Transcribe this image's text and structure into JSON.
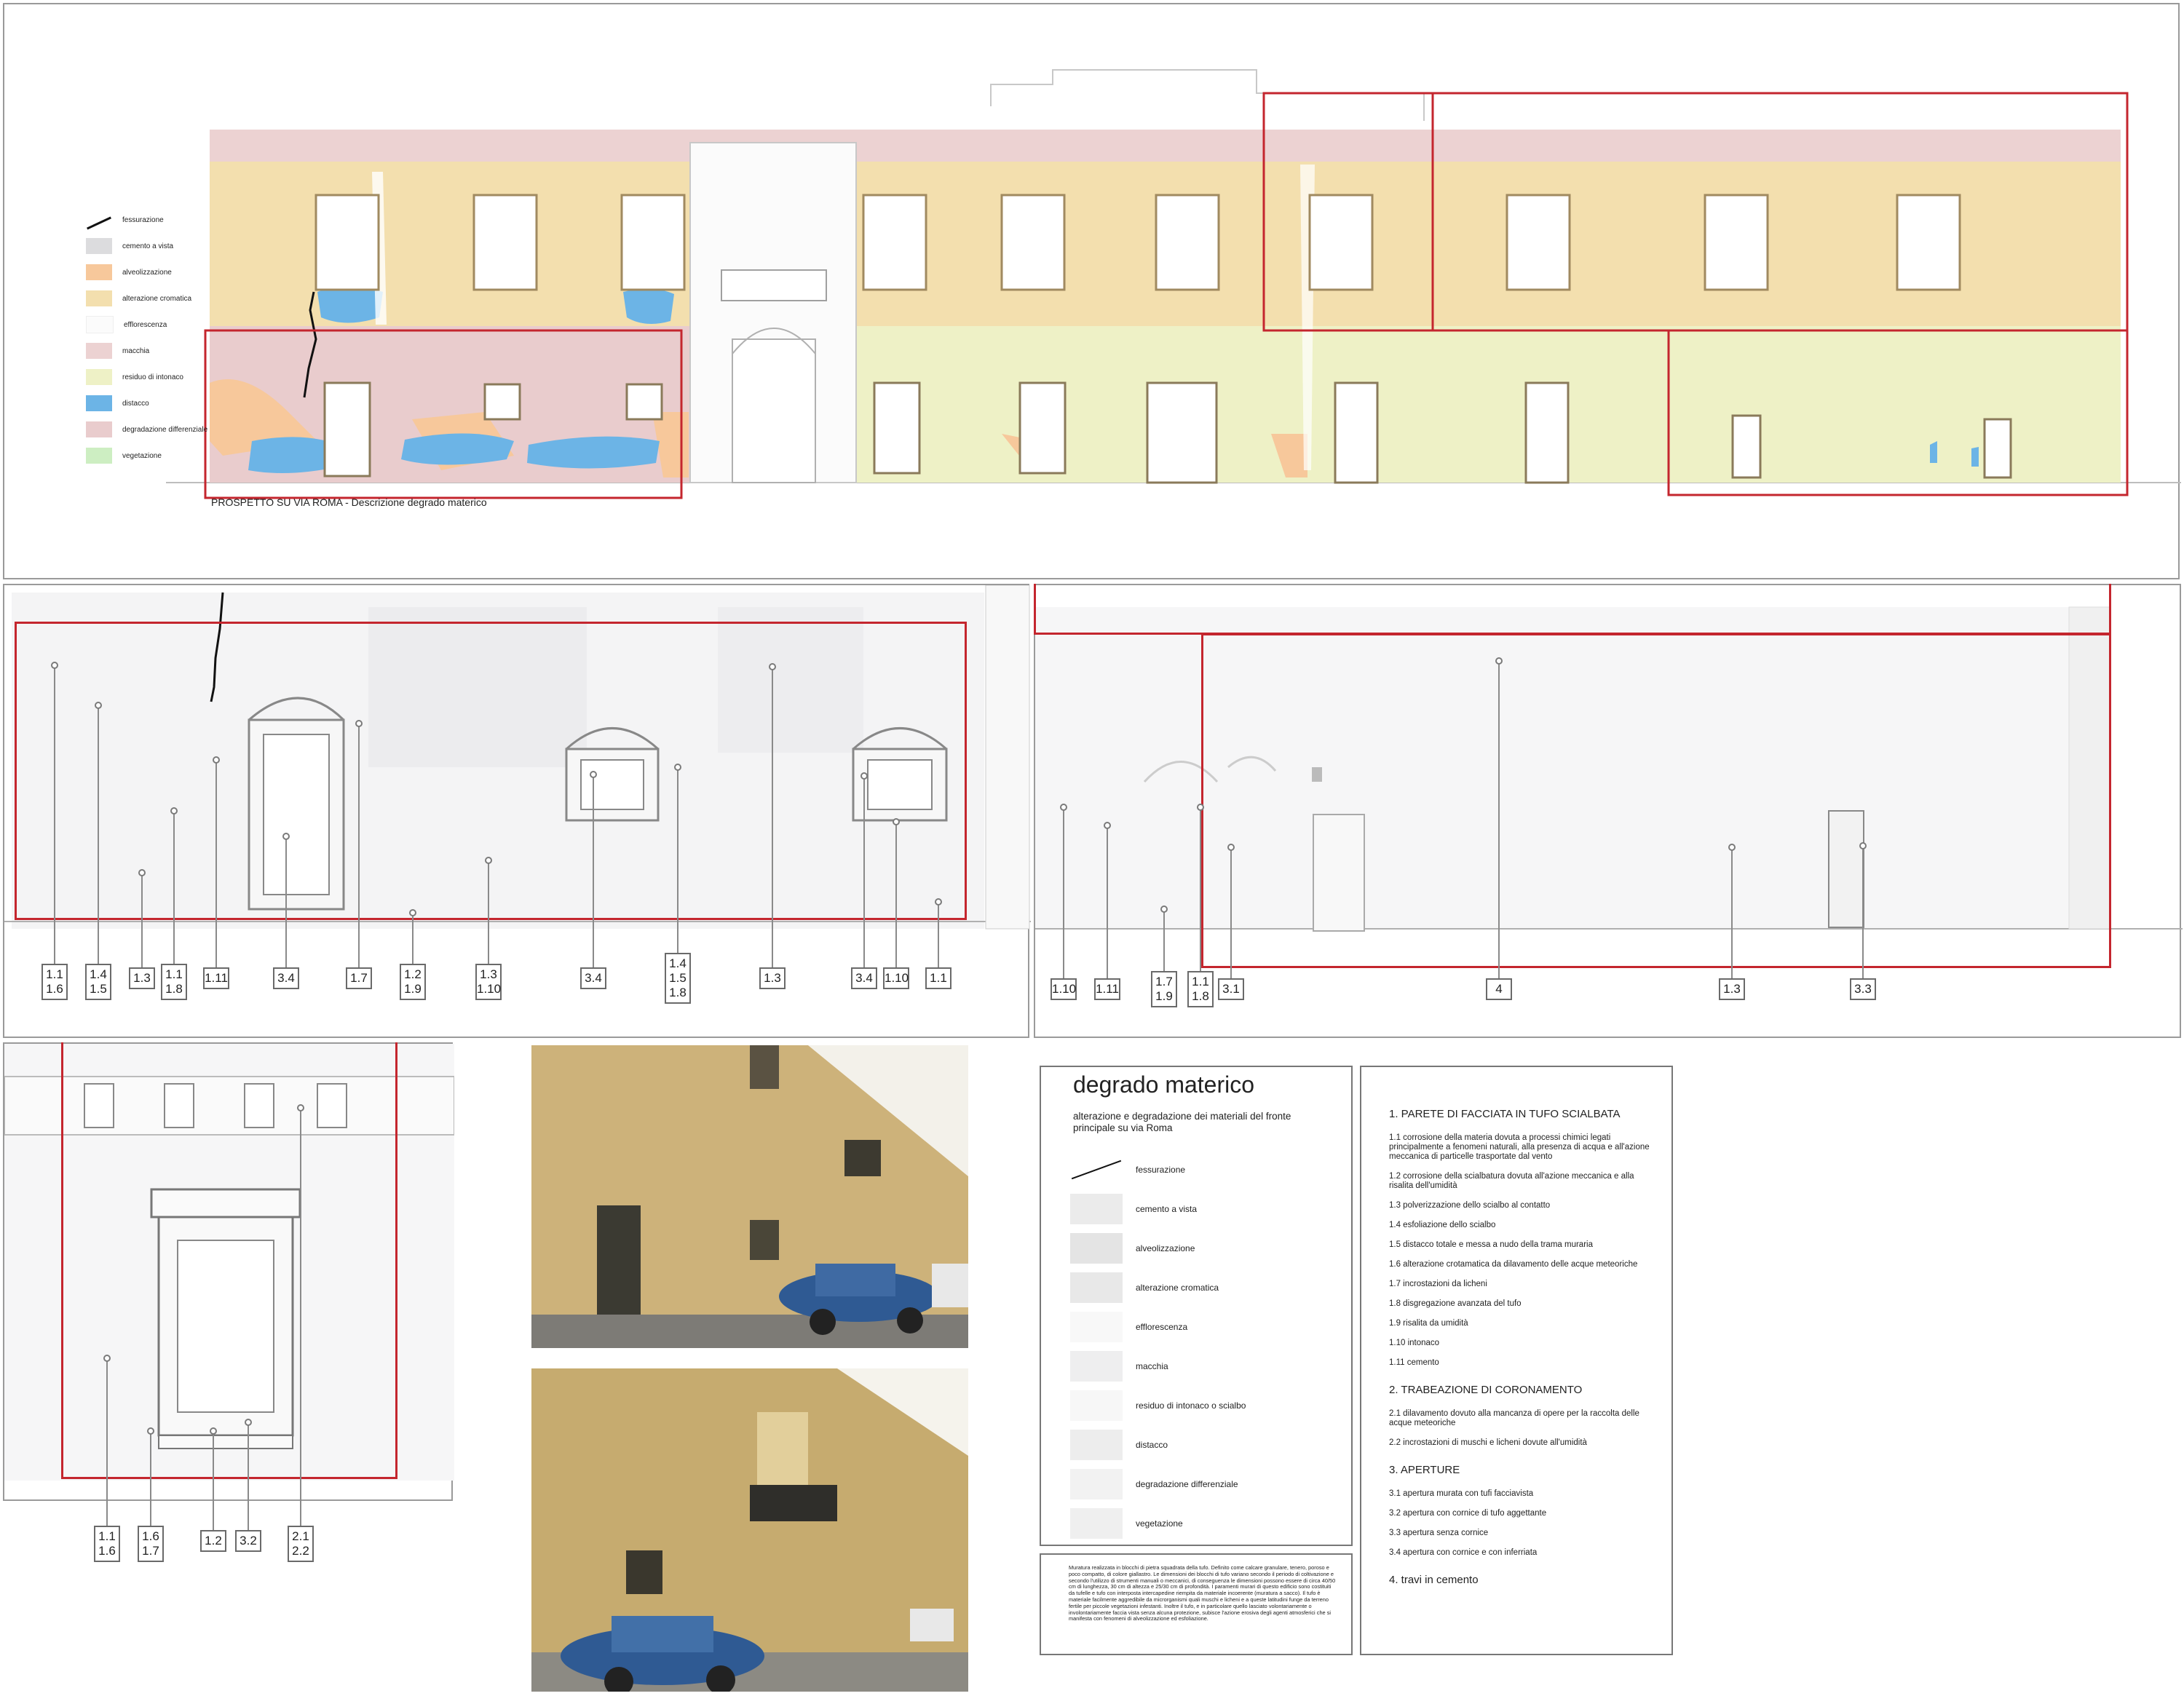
{
  "elevation": {
    "caption": "PROSPETTO SU VIA ROMA - Descrizione degrado materico",
    "legend": [
      {
        "label": "fessurazione",
        "color": "#111111",
        "kind": "crack"
      },
      {
        "label": "cemento a vista",
        "color": "#dcdcde"
      },
      {
        "label": "alveolizzazione",
        "color": "#f7c89b"
      },
      {
        "label": "alterazione cromatica",
        "color": "#f3dfae"
      },
      {
        "label": "efflorescenza",
        "color": "#fbfbfb"
      },
      {
        "label": "macchia",
        "color": "#ecd2d2"
      },
      {
        "label": "residuo di intonaco",
        "color": "#eef1c6"
      },
      {
        "label": "distacco",
        "color": "#6cb4e6"
      },
      {
        "label": "degradazione differenziale",
        "color": "#e9cccd"
      },
      {
        "label": "vegetazione",
        "color": "#cdeec2"
      }
    ]
  },
  "detail_left": {
    "tags": [
      [
        "1.1",
        "1.6"
      ],
      [
        "1.4",
        "1.5"
      ],
      [
        "1.3"
      ],
      [
        "1.1",
        "1.8"
      ],
      [
        "1.11"
      ],
      [
        "3.4"
      ],
      [
        "1.7"
      ],
      [
        "1.2",
        "1.9"
      ],
      [
        "1.3",
        "1.10"
      ],
      [
        "3.4"
      ],
      [
        "1.4",
        "1.5",
        "1.8"
      ],
      [
        "1.3"
      ],
      [
        "3.4"
      ],
      [
        "1.10"
      ],
      [
        "1.1"
      ]
    ]
  },
  "detail_right": {
    "tags": [
      [
        "1.10"
      ],
      [
        "1.11"
      ],
      [
        "1.7",
        "1.9"
      ],
      [
        "1.1",
        "1.8"
      ],
      [
        "3.1"
      ],
      [
        "4"
      ],
      [
        "1.3"
      ],
      [
        "3.3"
      ]
    ]
  },
  "detail_window": {
    "tags": [
      [
        "1.1",
        "1.6"
      ],
      [
        "1.6",
        "1.7"
      ],
      [
        "1.2"
      ],
      [
        "3.2"
      ],
      [
        "2.1",
        "2.2"
      ]
    ]
  },
  "key": {
    "title": "degrado materico",
    "subtitle": "alterazione e degradazione dei materiali del fronte principale su via Roma",
    "items": [
      "fessurazione",
      "cemento a vista",
      "alveolizzazione",
      "alterazione cromatica",
      "efflorescenza",
      "macchia",
      "residuo di intonaco o scialbo",
      "distacco",
      "degradazione differenziale",
      "vegetazione"
    ],
    "note": "Muratura realizzata in blocchi di pietra squadrata della tufo. Definito come calcare granulare, tenero, poroso e poco compatto, di colore giallastro. Le dimensioni dei blocchi di tufo variano secondo il periodo di coltivazione e secondo l'utilizzo di strumenti manuali o meccanici, di conseguenza le dimensioni possono essere di circa 40/50 cm di lunghezza, 30 cm di altezza e 25/30 cm di profondità. I paramenti murari di questo edificio sono costituiti da tufelle e tufo con interposta intercapedine riempita da materiale incoerente (muratura a sacco). Il tufo è materiale facilmente aggredibile da microrganismi quali muschi e licheni e a queste latitudini funge da terreno fertile per piccole vegetazioni infestanti. Inoltre il tufo, e in particolare quello lasciato volontariamente o involontariamente faccia vista senza alcuna protezione, subisce l'azione erosiva degli agenti atmosferici che si manifesta con fenomeni di alveolizzazione ed esfoliazione."
  },
  "descriptions": {
    "sections": [
      {
        "heading": "1. PARETE DI FACCIATA IN TUFO SCIALBATA",
        "items": [
          "1.1 corrosione della materia dovuta a processi chimici legati principalmente a fenomeni naturali, alla presenza di acqua e all'azione meccanica di particelle trasportate dal vento",
          "1.2 corrosione della scialbatura dovuta all'azione meccanica e alla risalita dell'umidità",
          "1.3 polverizzazione dello scialbo al contatto",
          "1.4 esfoliazione dello scialbo",
          "1.5 distacco totale e messa a nudo della trama muraria",
          "1.6 alterazione crotamatica da dilavamento delle acque meteoriche",
          "1.7 incrostazioni da licheni",
          "1.8 disgregazione avanzata del tufo",
          "1.9 risalita da umidità",
          "1.10 intonaco",
          "1.11 cemento"
        ]
      },
      {
        "heading": "2. TRABEAZIONE DI CORONAMENTO",
        "items": [
          "2.1 dilavamento dovuto alla mancanza di opere per la raccolta delle acque meteoriche",
          "2.2 incrostazioni di muschi e licheni dovute all'umidità"
        ]
      },
      {
        "heading": "3. APERTURE",
        "items": [
          "3.1 apertura murata con tufi facciavista",
          "3.2 apertura con cornice di tufo aggettante",
          "3.3 apertura senza cornice",
          "3.4 apertura con cornice e con inferriata"
        ]
      },
      {
        "heading": "4. travi in cemento",
        "items": []
      }
    ]
  }
}
